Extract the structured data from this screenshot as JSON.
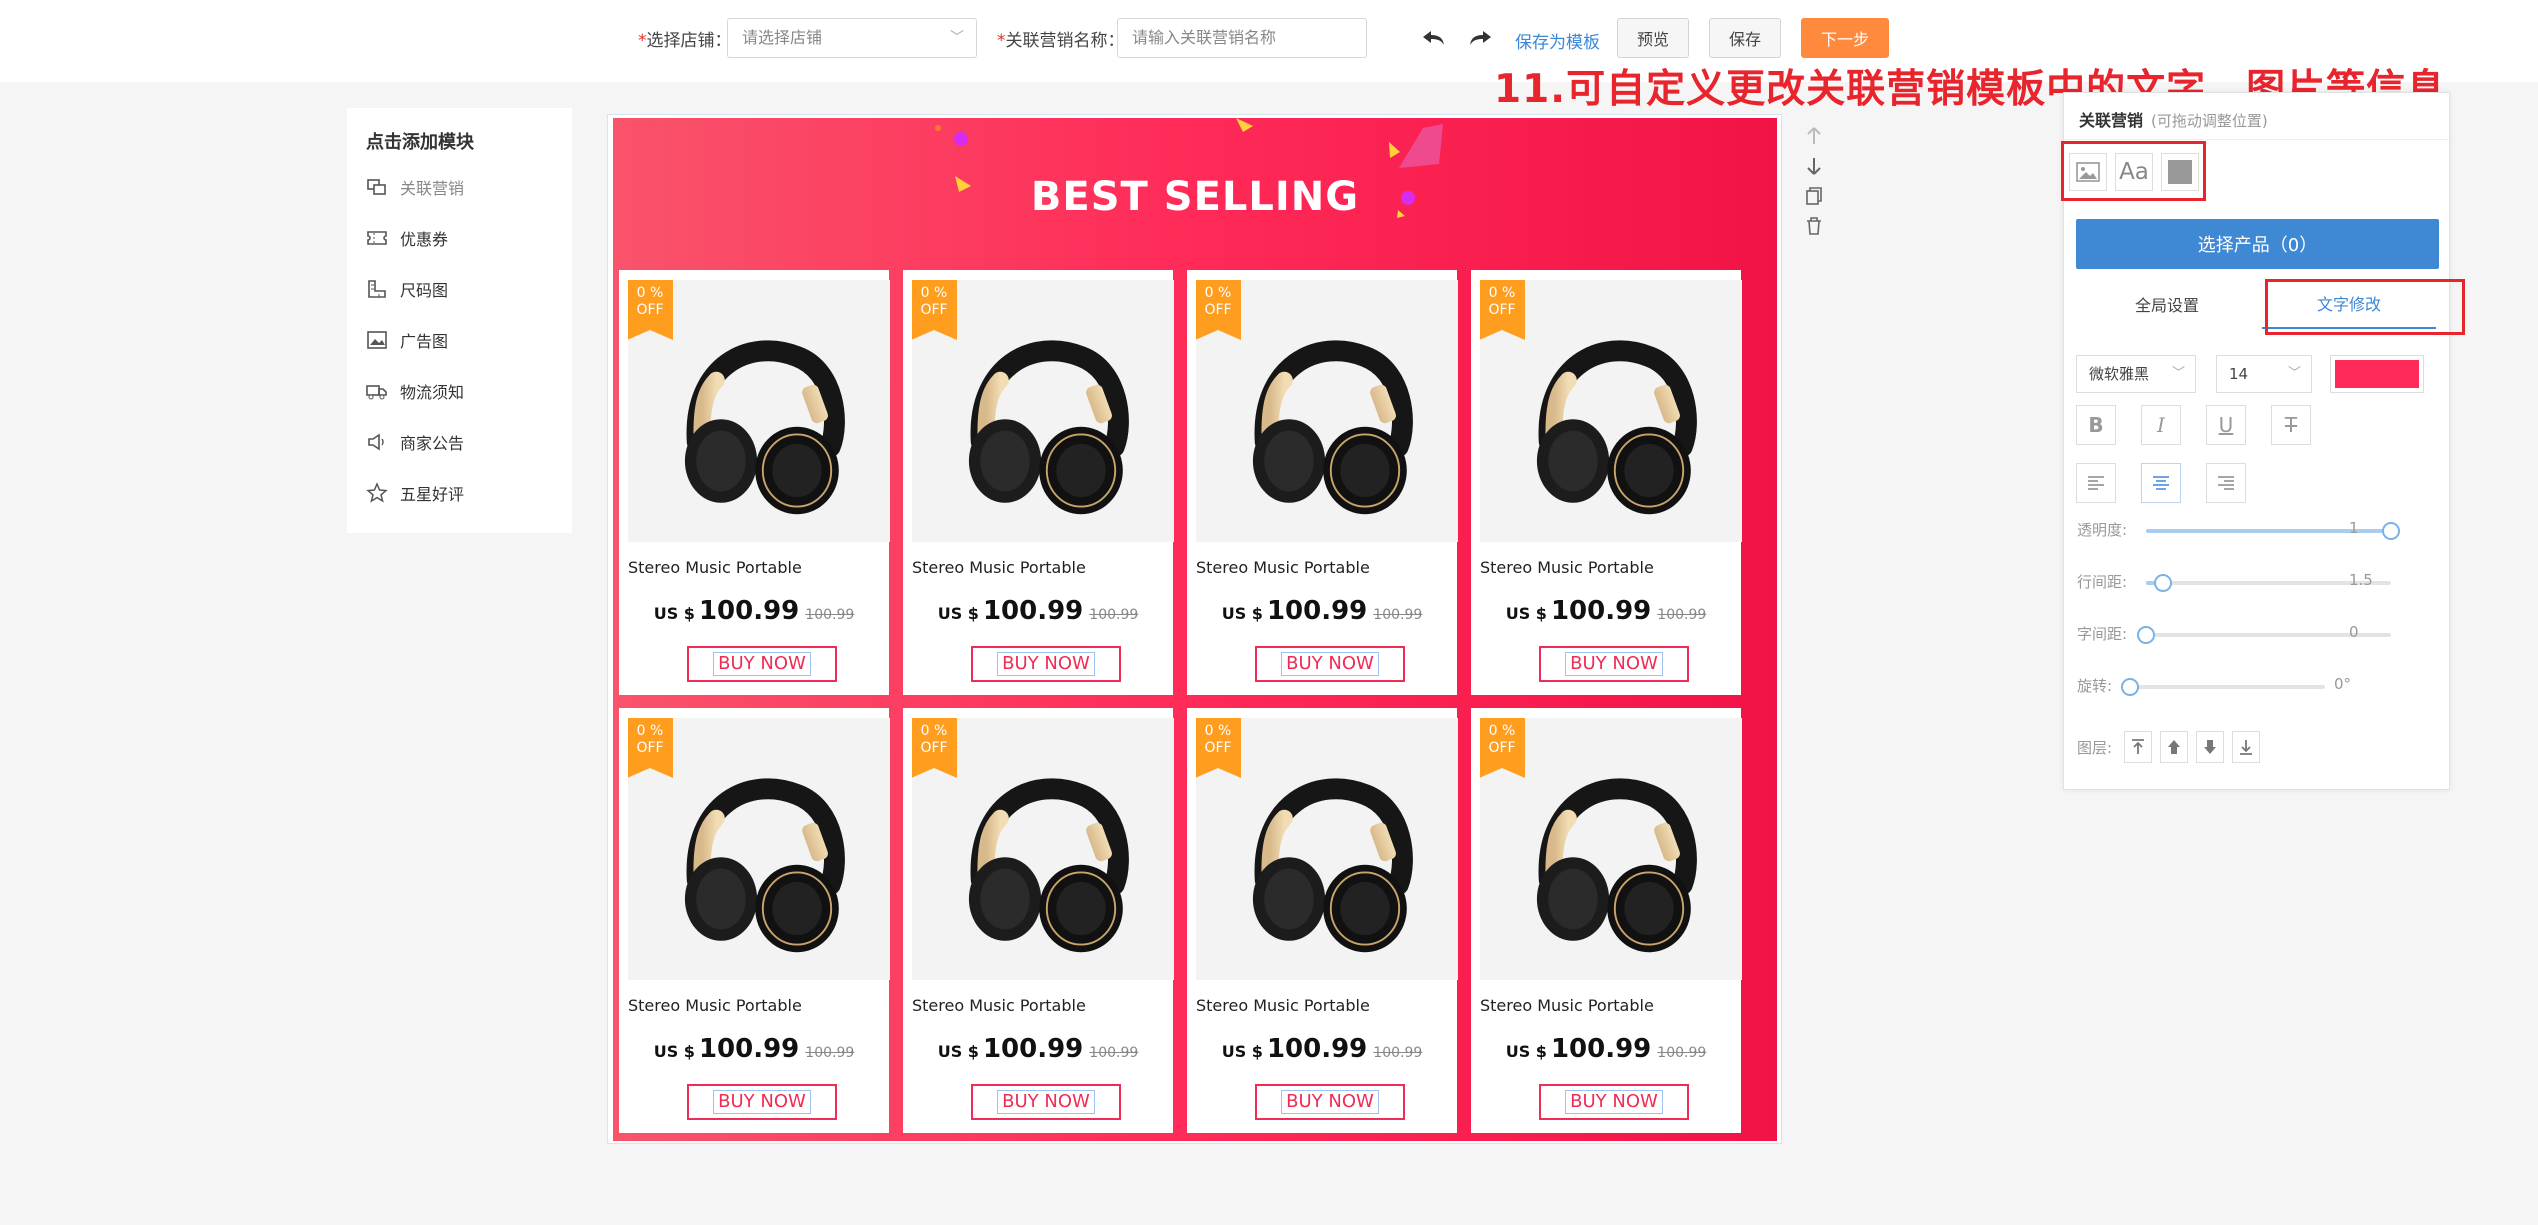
{
  "topbar": {
    "shop_label": "选择店铺：",
    "shop_placeholder": "请选择店铺",
    "name_label": "关联营销名称：",
    "name_placeholder": "请输入关联营销名称",
    "save_template": "保存为模板",
    "preview": "预览",
    "save": "保存",
    "next": "下一步"
  },
  "annotation": "11.可自定义更改关联营销模板中的文字、图片等信息",
  "sidebar": {
    "title": "点击添加模块",
    "items": [
      {
        "label": "关联营销",
        "icon": "related-marketing-icon"
      },
      {
        "label": "优惠券",
        "icon": "coupon-icon"
      },
      {
        "label": "尺码图",
        "icon": "size-chart-icon"
      },
      {
        "label": "广告图",
        "icon": "ad-image-icon"
      },
      {
        "label": "物流须知",
        "icon": "logistics-icon"
      },
      {
        "label": "商家公告",
        "icon": "announcement-icon"
      },
      {
        "label": "五星好评",
        "icon": "star-icon"
      }
    ]
  },
  "banner": {
    "title": "BEST SELLING",
    "accent_color": "#ff2a58"
  },
  "products": [
    {
      "badge_top": "0 %",
      "badge_bottom": "OFF",
      "name": "Stereo Music Portable",
      "currency": "US $",
      "price": "100.99",
      "old_price": "100.99",
      "button": "BUY NOW"
    },
    {
      "badge_top": "0 %",
      "badge_bottom": "OFF",
      "name": "Stereo Music Portable",
      "currency": "US $",
      "price": "100.99",
      "old_price": "100.99",
      "button": "BUY NOW"
    },
    {
      "badge_top": "0 %",
      "badge_bottom": "OFF",
      "name": "Stereo Music Portable",
      "currency": "US $",
      "price": "100.99",
      "old_price": "100.99",
      "button": "BUY NOW"
    },
    {
      "badge_top": "0 %",
      "badge_bottom": "OFF",
      "name": "Stereo Music Portable",
      "currency": "US $",
      "price": "100.99",
      "old_price": "100.99",
      "button": "BUY NOW"
    },
    {
      "badge_top": "0 %",
      "badge_bottom": "OFF",
      "name": "Stereo Music Portable",
      "currency": "US $",
      "price": "100.99",
      "old_price": "100.99",
      "button": "BUY NOW"
    },
    {
      "badge_top": "0 %",
      "badge_bottom": "OFF",
      "name": "Stereo Music Portable",
      "currency": "US $",
      "price": "100.99",
      "old_price": "100.99",
      "button": "BUY NOW"
    },
    {
      "badge_top": "0 %",
      "badge_bottom": "OFF",
      "name": "Stereo Music Portable",
      "currency": "US $",
      "price": "100.99",
      "old_price": "100.99",
      "button": "BUY NOW"
    },
    {
      "badge_top": "0 %",
      "badge_bottom": "OFF",
      "name": "Stereo Music Portable",
      "currency": "US $",
      "price": "100.99",
      "old_price": "100.99",
      "button": "BUY NOW"
    }
  ],
  "panel": {
    "title": "关联营销",
    "hint": "(可拖动调整位置)",
    "text_tool": "Aa",
    "select_products": "选择产品（0）",
    "tab_global": "全局设置",
    "tab_text": "文字修改",
    "font": "微软雅黑",
    "size": "14",
    "text_color": "#ff2a58",
    "sliders": [
      {
        "label": "透明度:",
        "value": "1",
        "fraction": 1.0
      },
      {
        "label": "行间距:",
        "value": "1.5",
        "fraction": 0.07
      },
      {
        "label": "字间距:",
        "value": "0",
        "fraction": 0.0
      },
      {
        "label": "旋转:",
        "value": "0°",
        "fraction": 0.0
      }
    ],
    "layer_label": "图层:"
  }
}
